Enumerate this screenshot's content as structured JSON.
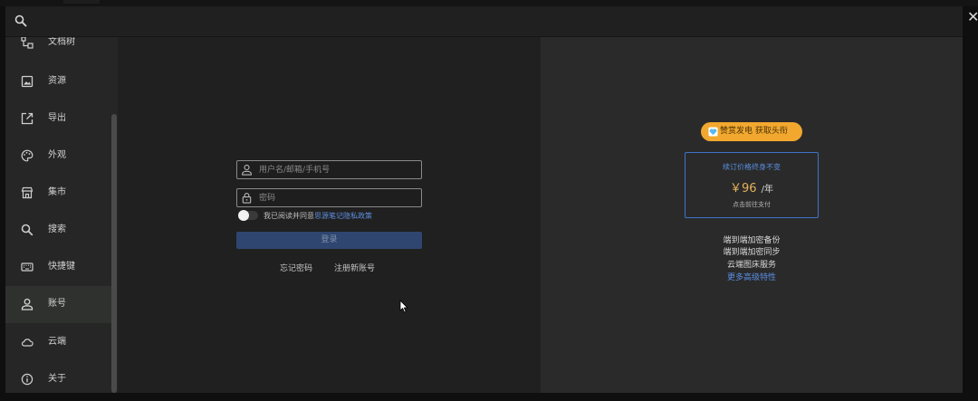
{
  "search": {
    "placeholder": "",
    "value": ""
  },
  "sidebar": {
    "items": [
      {
        "label": "文档树",
        "icon": "document-tree-icon"
      },
      {
        "label": "资源",
        "icon": "image-icon"
      },
      {
        "label": "导出",
        "icon": "export-icon"
      },
      {
        "label": "外观",
        "icon": "palette-icon"
      },
      {
        "label": "集市",
        "icon": "store-icon"
      },
      {
        "label": "搜索",
        "icon": "search-icon"
      },
      {
        "label": "快捷键",
        "icon": "keyboard-icon"
      },
      {
        "label": "账号",
        "icon": "account-icon",
        "active": true
      },
      {
        "label": "云端",
        "icon": "cloud-icon"
      },
      {
        "label": "关于",
        "icon": "info-icon"
      }
    ]
  },
  "login": {
    "username_placeholder": "用户名/邮箱/手机号",
    "password_placeholder": "密码",
    "agree_text": "我已阅读并同意",
    "agree_link": "思源笔记隐私政策",
    "login_button": "登录",
    "forgot_password": "忘记密码",
    "register": "注册新账号"
  },
  "promo": {
    "badge": "赞赏发电 获取头衔",
    "subscription_title": "续订价格终身不变",
    "price": "￥96",
    "price_unit": "/年",
    "price_note": "点击前往支付",
    "features": [
      "端到端加密备份",
      "端到端加密同步",
      "云端图床服务"
    ],
    "more_link": "更多高级特性"
  },
  "colors": {
    "accent_blue": "#5e8fe0",
    "promo_orange": "#f2a82f",
    "login_button": "#2e4670"
  }
}
